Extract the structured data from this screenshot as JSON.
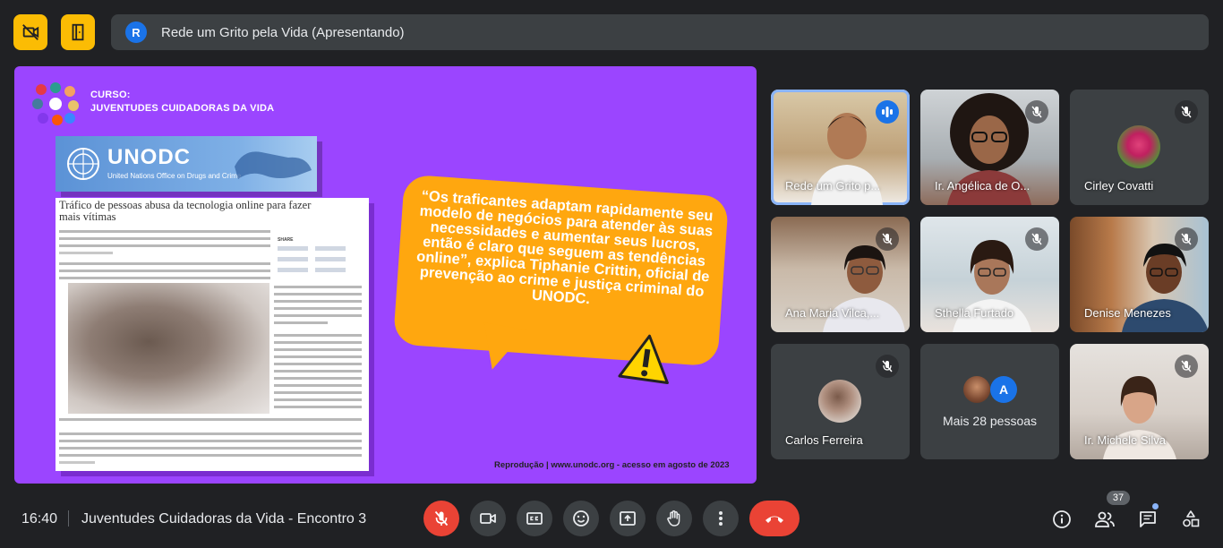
{
  "presenter": {
    "initial": "R",
    "label": "Rede um Grito pela Vida (Apresentando)"
  },
  "slide": {
    "course_label": "CURSO:",
    "course_name": "JUVENTUDES CUIDADORAS DA VIDA",
    "banner_title": "UNODC",
    "banner_subtitle": "United Nations Office on Drugs and Crime",
    "article_headline": "Tráfico de pessoas abusa da tecnologia online para fazer mais vítimas",
    "article_share": "SHARE",
    "quote": "“Os traficantes adaptam rapidamente seu modelo de negócios para atender às suas necessidades e aumentar seus lucros, então é claro que seguem as tendências online”, explica Tiphanie Crittin, oficial de prevenção ao crime e justiça criminal do UNODC.",
    "credit": "Reprodução | www.unodc.org - acesso em agosto de 2023"
  },
  "participants": [
    {
      "name": "Rede um Grito p...",
      "speaking": true
    },
    {
      "name": "Ir. Angélica de O...",
      "muted": true
    },
    {
      "name": "Cirley Covatti",
      "muted": true
    },
    {
      "name": "Ana Maria Vilca,...",
      "muted": true
    },
    {
      "name": "Sthella Furtado",
      "muted": true
    },
    {
      "name": "Denise Menezes",
      "muted": true
    },
    {
      "name": "Carlos Ferreira",
      "muted": true
    },
    {
      "name": "Mais 28 pessoas",
      "others_initial": "A"
    },
    {
      "name": "Ir. Michele Silva",
      "muted": true
    }
  ],
  "bottom": {
    "time": "16:40",
    "meeting_title": "Juventudes Cuidadoras da Vida - Encontro 3",
    "people_count": "37"
  },
  "colors": {
    "accent": "#fbbc04",
    "slide_bg": "#9b45ff",
    "bubble": "#ffa70f",
    "danger": "#ea4335",
    "active": "#8ab4f8"
  }
}
